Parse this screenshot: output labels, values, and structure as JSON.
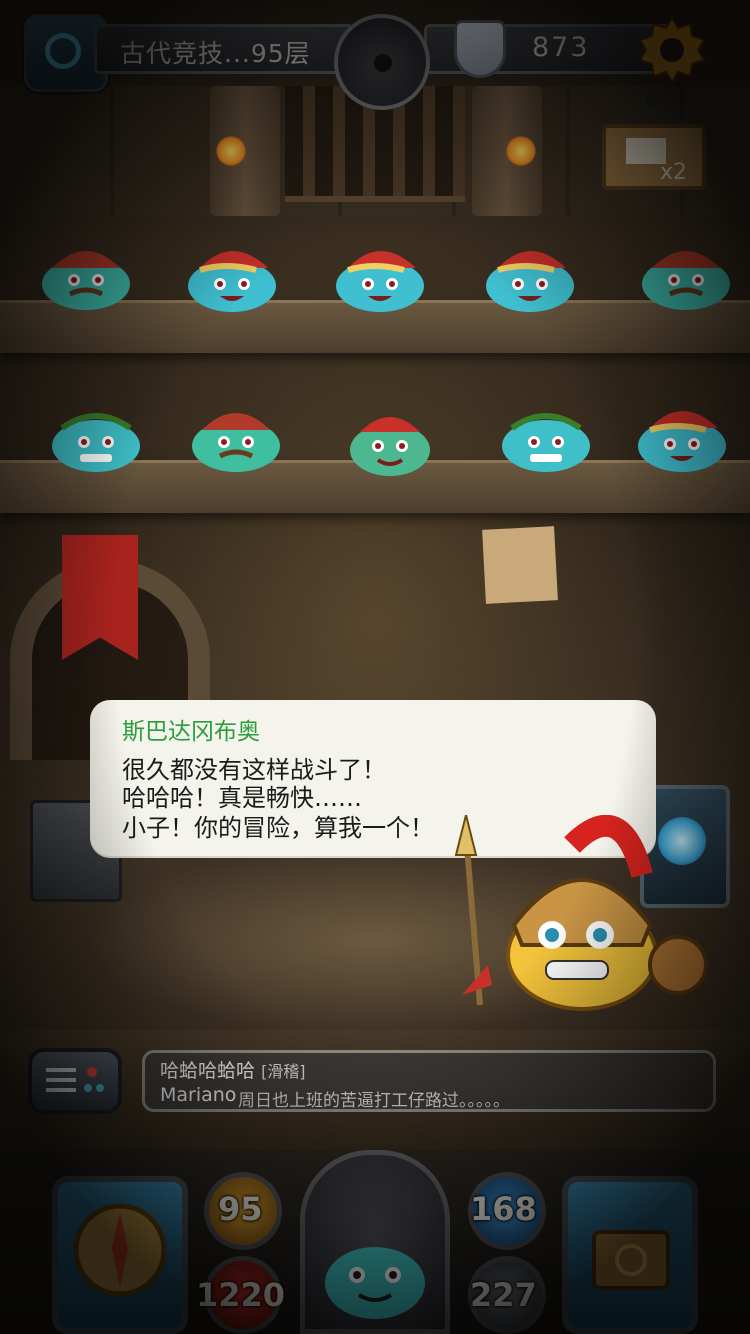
{
  "top_bar": {
    "level_label": "古代竞技...95层",
    "score": "873"
  },
  "cart": {
    "count_label": "x2"
  },
  "dialog": {
    "speaker": "斯巴达冈布奥",
    "lines": [
      "很久都没有这样战斗了！",
      "哈哈哈！真是畅快……",
      "小子！你的冒险，算我一个！"
    ]
  },
  "chat": {
    "line1_text": "哈蛤哈蛤哈",
    "line1_tag": "[滑稽]",
    "line2_name": "Mariano",
    "line2_text": "周日也上班的苦逼打工仔路过。。。。。"
  },
  "hud": {
    "attack": "95",
    "health": "1220",
    "magic": "168",
    "defense": "227"
  },
  "colors": {
    "speaker_green": "#2a9d3c",
    "dialog_bg": "#f4f4ec",
    "hud_text": "#e8e4d8"
  },
  "icons": {
    "portal": "portal-icon",
    "compass": "compass-icon",
    "score": "shield-icon",
    "settings": "gear-icon",
    "chat": "chat-menu-icon",
    "left_slot": "compass-hero-icon",
    "right_slot": "magic-book-icon"
  }
}
